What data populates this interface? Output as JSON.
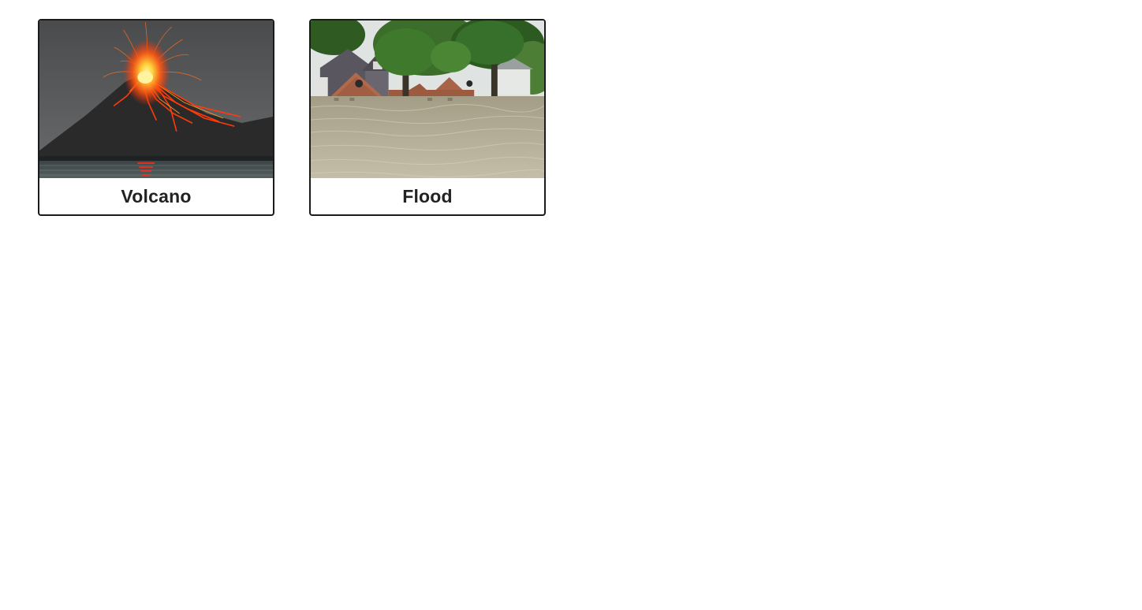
{
  "cards": [
    {
      "label": "Volcano",
      "image": "volcano-eruption-photo"
    },
    {
      "label": "Flood",
      "image": "flooded-houses-photo"
    }
  ]
}
